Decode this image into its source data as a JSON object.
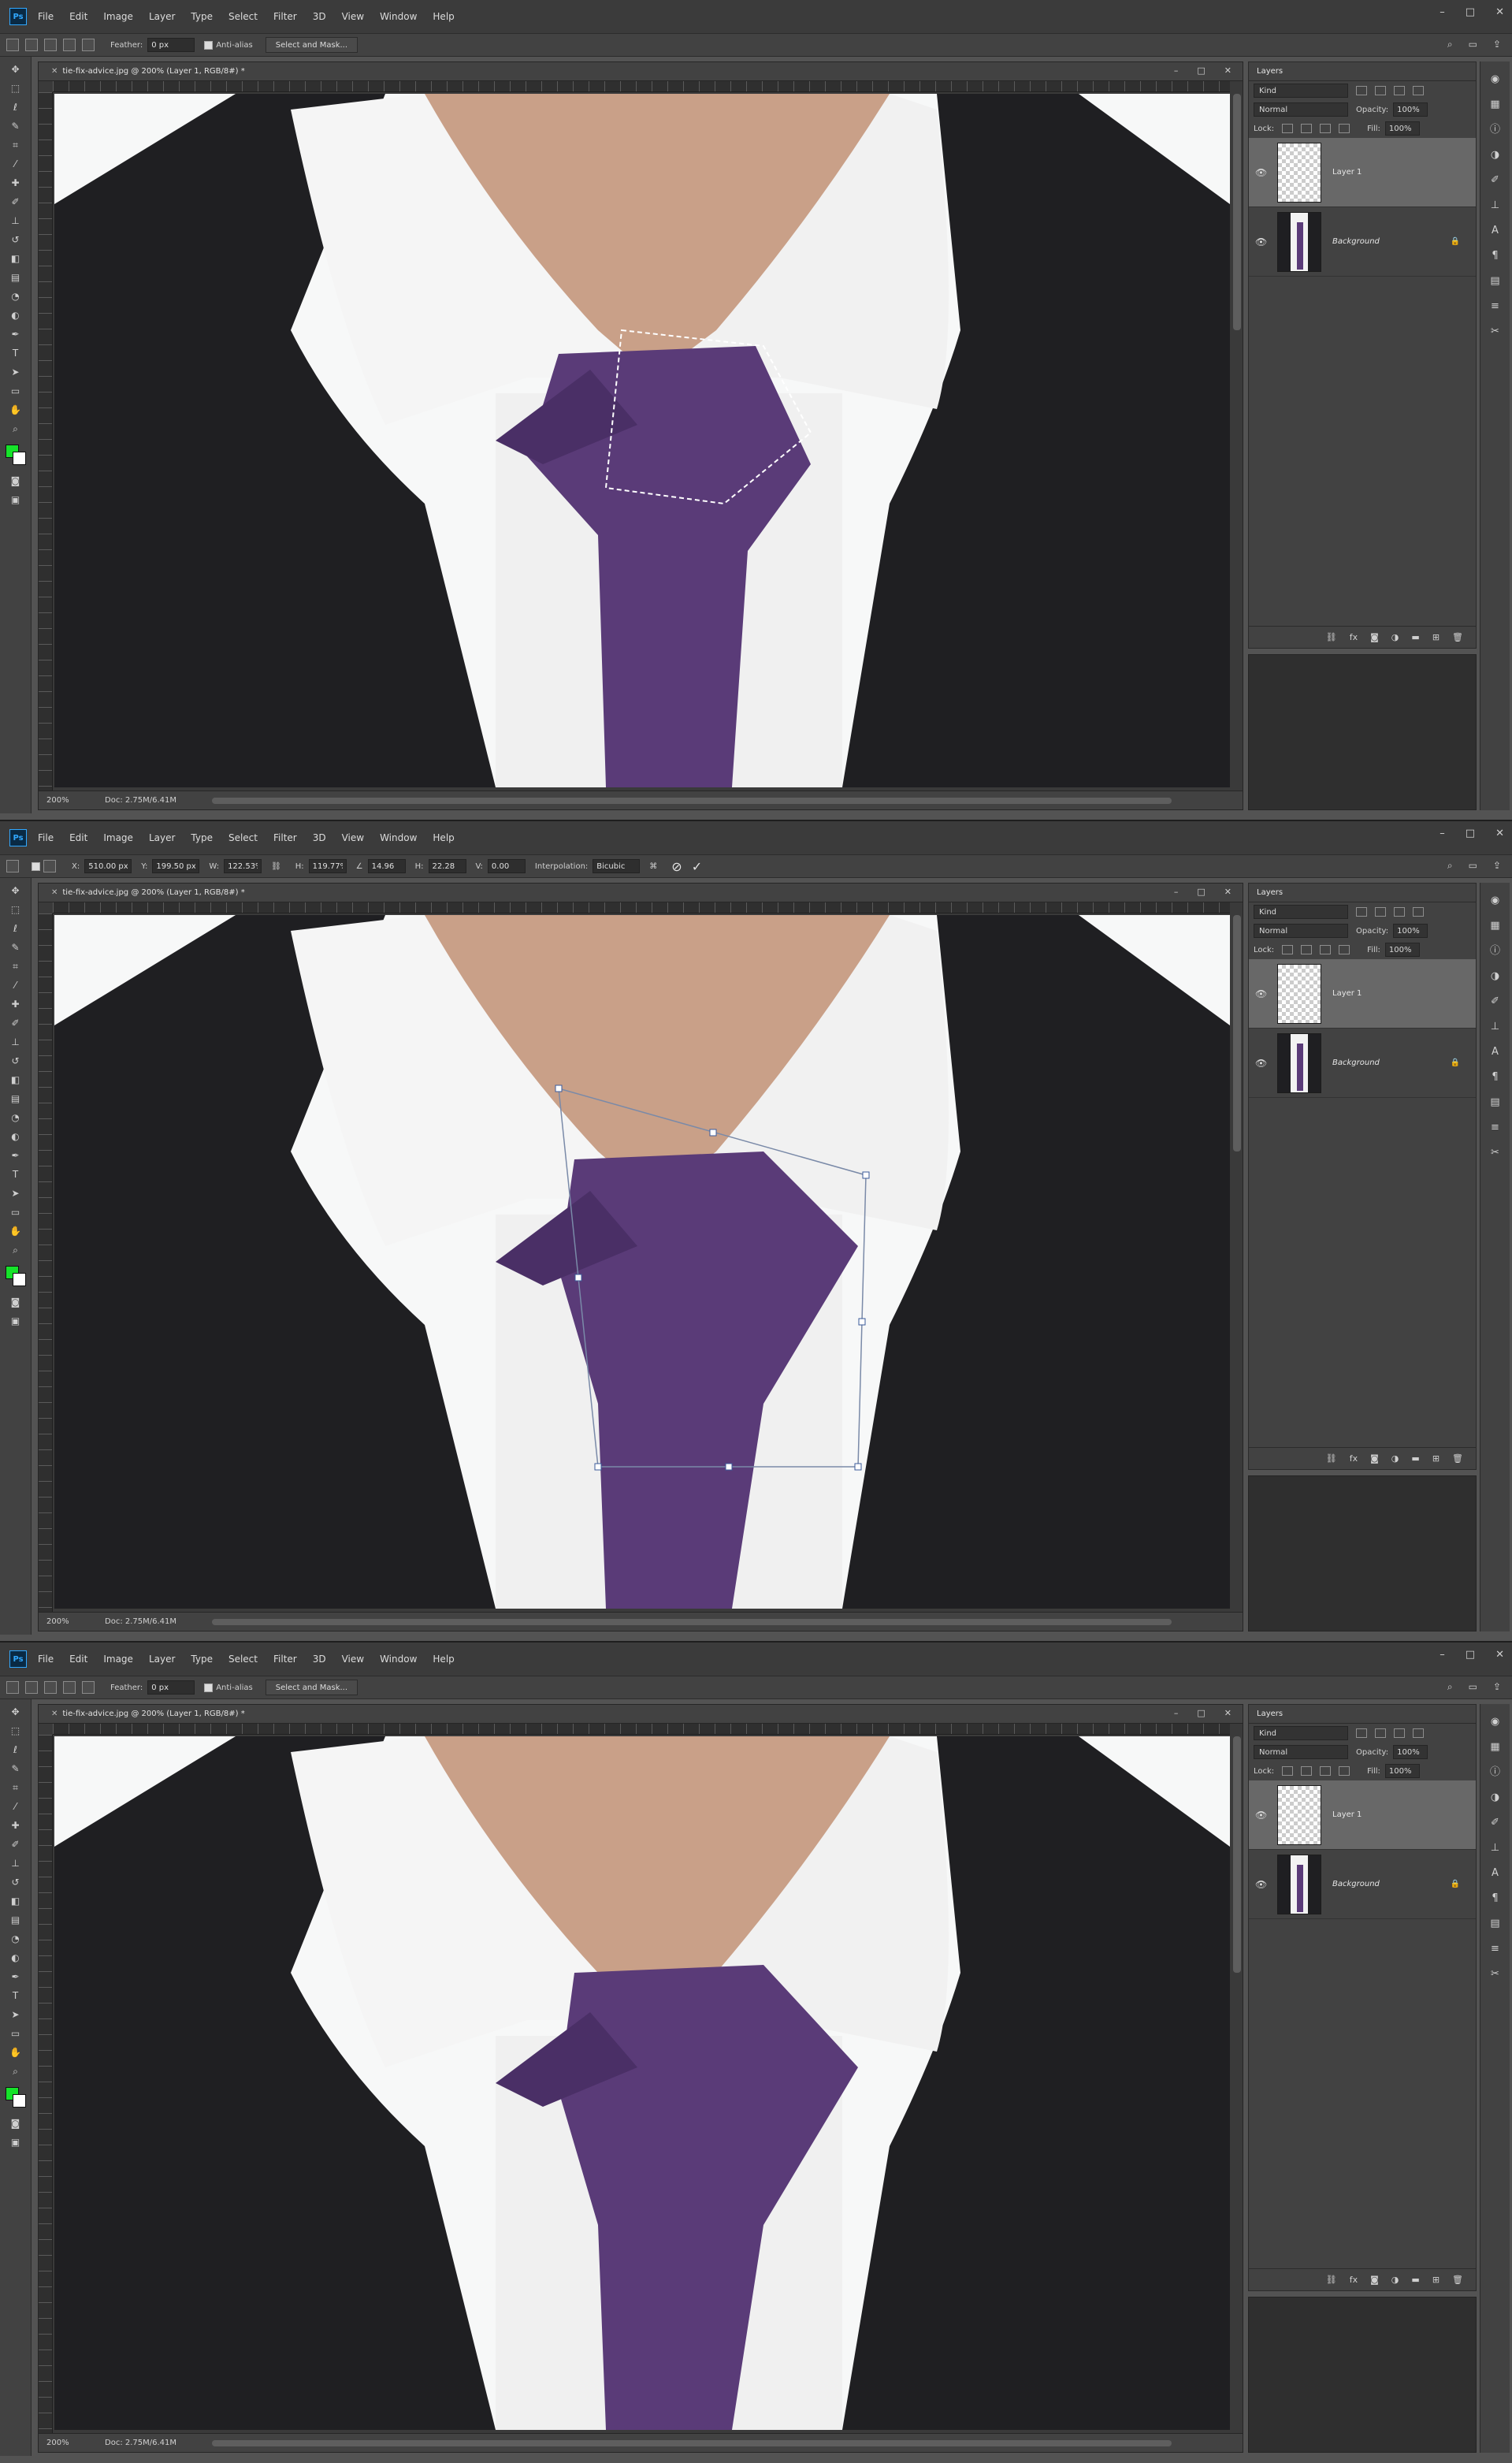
{
  "app": {
    "logo": "Ps",
    "menu": [
      "File",
      "Edit",
      "Image",
      "Layer",
      "Type",
      "Select",
      "Filter",
      "3D",
      "View",
      "Window",
      "Help"
    ],
    "window_controls": [
      "–",
      "□",
      "✕"
    ]
  },
  "document": {
    "title": "tie-fix-advice.jpg @ 200% (Layer 1, RGB/8#) *",
    "zoom": "200%",
    "doc_size": "Doc: 2.75M/6.41M"
  },
  "lasso_options": {
    "feather_label": "Feather:",
    "feather_value": "0 px",
    "anti_alias_label": "Anti-alias",
    "select_mask_label": "Select and Mask..."
  },
  "transform_options": {
    "x_label": "X:",
    "x_value": "510.00 px",
    "y_label": "Y:",
    "y_value": "199.50 px",
    "w_label": "W:",
    "w_value": "122.53%",
    "h_label": "H:",
    "h_value": "119.77%",
    "angle_value": "14.96",
    "hskew_label": "H:",
    "hskew_value": "22.28",
    "vskew_label": "V:",
    "vskew_value": "0.00",
    "interp_label": "Interpolation:",
    "interp_value": "Bicubic",
    "cancel_glyph": "⊘",
    "commit_glyph": "✓"
  },
  "layers_panel": {
    "tab": "Layers",
    "filter_kind": "Kind",
    "blend_mode": "Normal",
    "opacity_label": "Opacity:",
    "opacity_value": "100%",
    "lock_label": "Lock:",
    "fill_label": "Fill:",
    "fill_value": "100%",
    "layers": [
      {
        "name": "Layer 1",
        "selected": true
      },
      {
        "name": "Background",
        "locked": true
      }
    ],
    "footer_icons": [
      "link-icon",
      "fx-icon",
      "mask-icon",
      "adjustment-icon",
      "folder-icon",
      "new-layer-icon",
      "trash-icon"
    ]
  },
  "colors": {
    "foreground": "#16e32a",
    "background": "#ffffff",
    "tie": "#5a3b78",
    "jacket": "#1f1f22",
    "shirt": "#f5f5f5"
  }
}
